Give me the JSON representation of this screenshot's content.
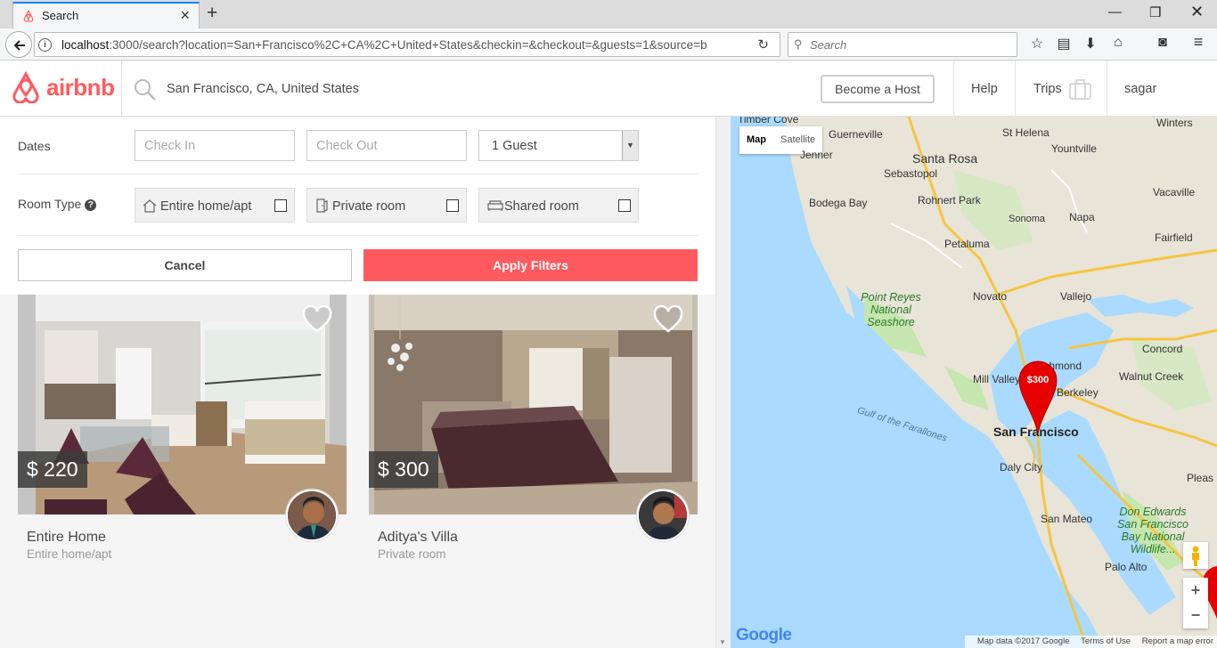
{
  "browser": {
    "tab_title": "Search",
    "url_host": "localhost",
    "url_rest": ":3000/search?location=San+Francisco%2C+CA%2C+United+States&checkin=&checkout=&guests=1&source=b",
    "search_placeholder": "Search"
  },
  "header": {
    "logo_text": "airbnb",
    "location": "San Francisco, CA, United States",
    "become_host": "Become a Host",
    "help": "Help",
    "trips": "Trips",
    "user": "sagar"
  },
  "filters": {
    "dates_label": "Dates",
    "checkin_placeholder": "Check In",
    "checkout_placeholder": "Check Out",
    "guests_value": "1 Guest",
    "room_type_label": "Room Type",
    "room_types": [
      {
        "label": "Entire home/apt",
        "checked": false
      },
      {
        "label": "Private room",
        "checked": false
      },
      {
        "label": "Shared room",
        "checked": false
      }
    ],
    "cancel": "Cancel",
    "apply": "Apply Filters"
  },
  "listings": [
    {
      "price": "$ 220",
      "title": "Entire Home",
      "room_type": "Entire home/apt"
    },
    {
      "price": "$ 300",
      "title": "Aditya's Villa",
      "room_type": "Private room"
    }
  ],
  "map": {
    "type_map": "Map",
    "type_satellite": "Satellite",
    "marker_price": "$300",
    "labels": {
      "timber_cove": "Timber Cove",
      "guerneville": "Guerneville",
      "jenner": "Jenner",
      "santa_rosa": "Santa Rosa",
      "sebastopol": "Sebastopol",
      "st_helena": "St Helena",
      "winters": "Winters",
      "yountville": "Yountville",
      "vacaville": "Vacaville",
      "rohnert_park": "Rohnert Park",
      "bodega_bay": "Bodega Bay",
      "sonoma": "Sonoma",
      "napa": "Napa",
      "fairfield": "Fairfield",
      "petaluma": "Petaluma",
      "point_reyes": "Point Reyes National Seashore",
      "novato": "Novato",
      "vallejo": "Vallejo",
      "concord": "Concord",
      "richmond": "Richmond",
      "mill_valley": "Mill Valley",
      "berkeley": "Berkeley",
      "walnut_creek": "Walnut Creek",
      "gulf_farallones": "Gulf of the Farallones",
      "san_francisco": "San Francisco",
      "daly_city": "Daly City",
      "san_mateo": "San Mateo",
      "don_edwards": "Don Edwards San Francisco Bay National Wildlife...",
      "palo_alto": "Palo Alto",
      "pleasanton": "Pleas"
    },
    "footer_data": "Map data ©2017 Google",
    "footer_terms": "Terms of Use",
    "footer_report": "Report a map error",
    "google": "Google"
  }
}
